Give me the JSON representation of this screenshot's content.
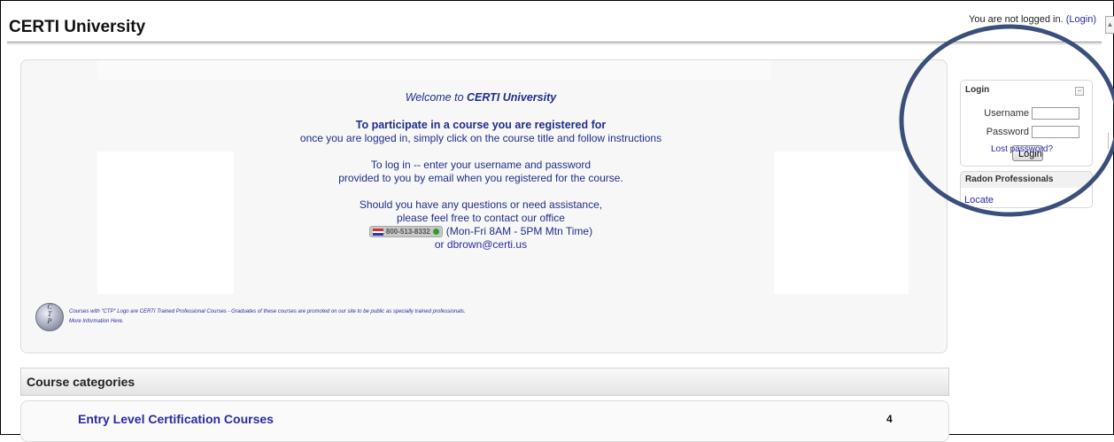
{
  "header": {
    "site_title": "CERTI University",
    "login_status_prefix": "You are not logged in.",
    "login_link": "(Login)"
  },
  "welcome": {
    "title_prefix": "Welcome to",
    "title_brand": "CERTI University",
    "para1_bold": "To participate in a course you are registered for",
    "para1_line2": "once you are logged in, simply click on the course title and follow instructions",
    "para2_line1": "To log in -- enter your username and password",
    "para2_line2": "provided to you by email when you registered for the course.",
    "para3_line1": "Should you have any questions or need assistance,",
    "para3_line2": "please feel free to contact our office",
    "phone_number": "800-513-8332",
    "phone_hours": "(Mon-Fri 8AM - 5PM Mtn Time)",
    "email_prefix": "or",
    "email": "dbrown@certi.us"
  },
  "ctp": {
    "logo_letters": [
      "C",
      "T",
      "P"
    ],
    "note": "Courses with \"CTP\" Logo are CERTI Trained Professional Courses - Graduates of these courses are promoted on our site to be public as specially trained professionals.",
    "more_info": "More Information Here."
  },
  "course_categories": {
    "header": "Course categories",
    "items": [
      {
        "name": "Entry Level Certification Courses",
        "count": "4"
      }
    ]
  },
  "login_block": {
    "title": "Login",
    "username_label": "Username",
    "password_label": "Password",
    "username_value": "",
    "password_value": "",
    "login_button": "Login",
    "lost_password": "Lost password?"
  },
  "professionals_block": {
    "title": "Radon Professionals",
    "locate_link": "Locate"
  },
  "colors": {
    "link_blue": "#2a2aa8",
    "welcome_blue": "#1f2e8a",
    "highlight_ellipse": "#3b4f7a"
  }
}
